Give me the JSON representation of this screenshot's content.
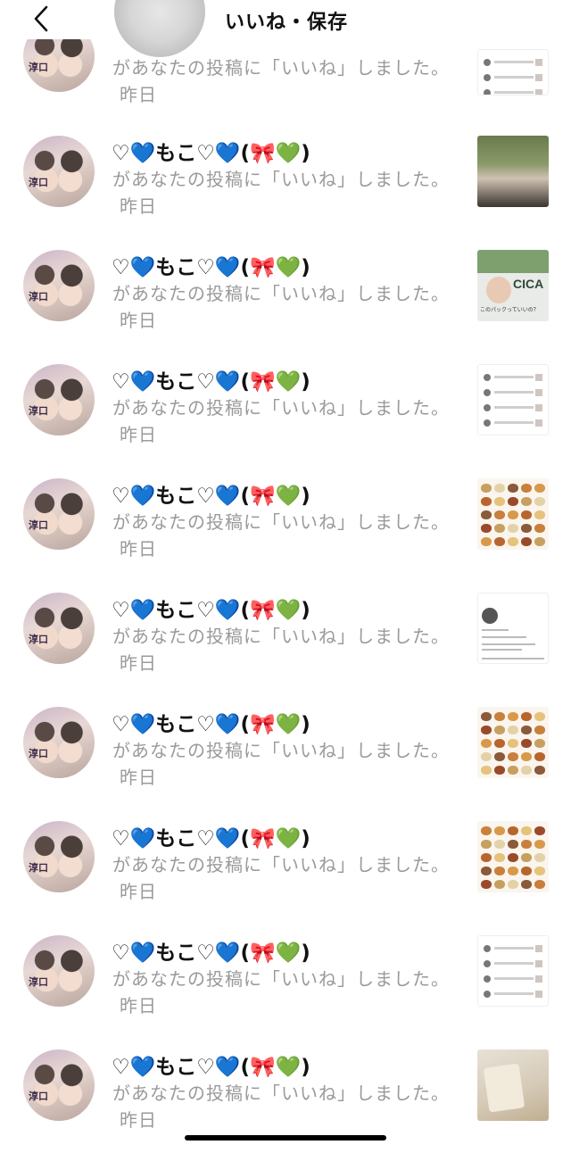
{
  "header": {
    "title": "いいね・保存",
    "back_icon": "chevron-left-icon"
  },
  "notification": {
    "user_name": "♡💙もこ♡💙(🎀💚)",
    "message": "があなたの投稿に「いいね」しました。",
    "time": "昨日",
    "avatar_tag": "淳口"
  },
  "items": [
    {
      "thumb": "list"
    },
    {
      "thumb": "photo"
    },
    {
      "thumb": "cica",
      "thumb_word": "CICA",
      "thumb_caption": "このパックっていいの？"
    },
    {
      "thumb": "list"
    },
    {
      "thumb": "food"
    },
    {
      "thumb": "profile"
    },
    {
      "thumb": "food"
    },
    {
      "thumb": "food"
    },
    {
      "thumb": "list"
    },
    {
      "thumb": "cup"
    }
  ],
  "colors": {
    "secondary_text": "#9a9a9a",
    "background": "#ffffff"
  }
}
